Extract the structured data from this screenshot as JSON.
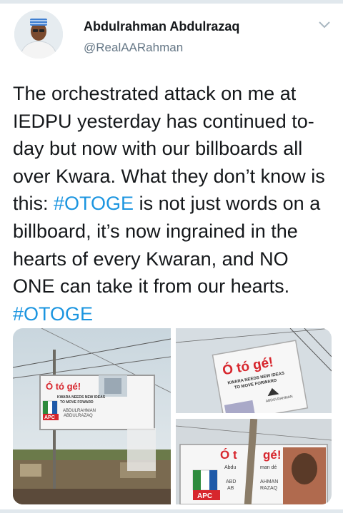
{
  "author": {
    "name": "Abdulrahman Abdulrazaq",
    "handle": "@RealAARahman",
    "avatar_icon": "user-avatar"
  },
  "tweet": {
    "segments": [
      {
        "text": "The orchestrated attack on me at IEDPU yesterday has continued to-day but now with our billboards all over Kwara. What they don’t know is this: ",
        "hashtag": false
      },
      {
        "text": "#OTOGE",
        "hashtag": true
      },
      {
        "text": " is not just words on a billboard, it’s now ingrained in the hearts of every Kwaran, and NO ONE can take it from our hearts. ",
        "hashtag": false
      },
      {
        "text": "#OTOGE",
        "hashtag": true
      }
    ]
  },
  "billboards": {
    "slogan": "Ó tó gé!",
    "tagline_1": "KWARA NEEDS NEW IDEAS",
    "tagline_2_left": "TO MOVE FOWARD",
    "tagline_2_right": "TO MOVE FORWARD",
    "candidate_line_1": "ABDULRAHMAN",
    "candidate_line_2": "ABDULRAZAQ",
    "party": "APC",
    "bottom_slogan_left": "Ó t",
    "bottom_slogan_right": "gé!",
    "bottom_sub_left": "Abdu",
    "bottom_sub_right": "man dé",
    "bottom_name_1a": "ABD",
    "bottom_name_1b": "AHMAN",
    "bottom_name_2a": "AB",
    "bottom_name_2b": "RAZAQ"
  },
  "colors": {
    "hashtag": "#1b95e0",
    "text": "#14171a",
    "muted": "#657786",
    "billboard_red": "#d7262d",
    "apc_green": "#2e8b3d",
    "apc_blue": "#1f5aa8"
  }
}
